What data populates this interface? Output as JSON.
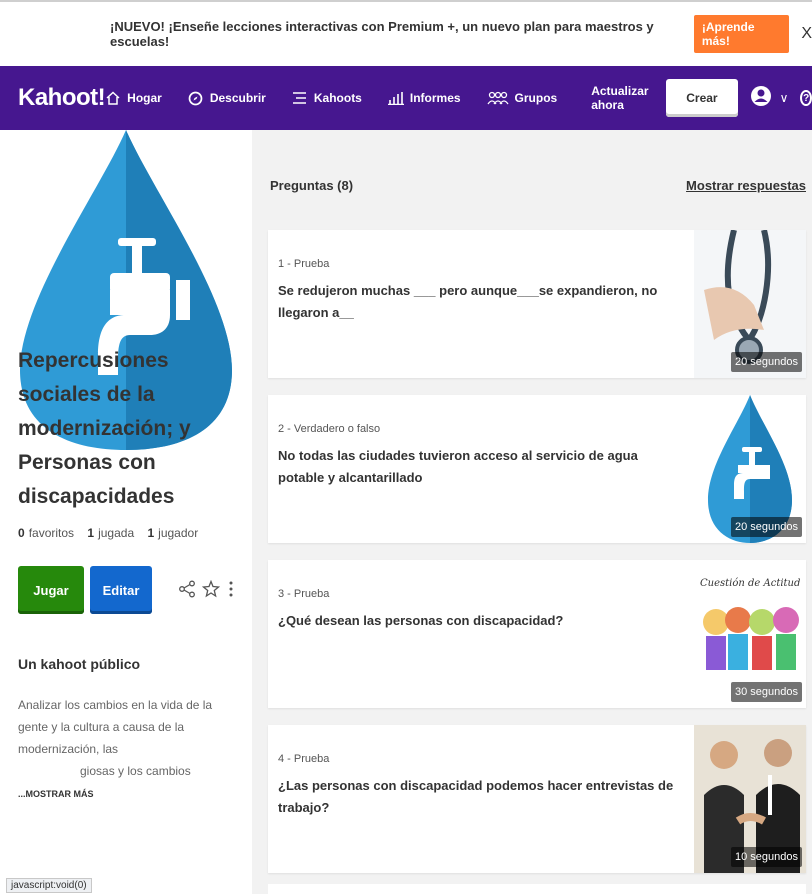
{
  "banner": {
    "text": "¡NUEVO! ¡Enseñe lecciones interactivas con Premium +, un nuevo plan para maestros y escuelas!",
    "button": "¡Aprende más!",
    "close": "X"
  },
  "nav": {
    "logo": "Kahoot!",
    "items": [
      {
        "label": "Hogar",
        "icon": "home-icon"
      },
      {
        "label": "Descubrir",
        "icon": "compass-icon"
      },
      {
        "label": "Kahoots",
        "icon": "list-icon"
      },
      {
        "label": "Informes",
        "icon": "reports-icon"
      },
      {
        "label": "Grupos",
        "icon": "groups-icon"
      }
    ],
    "upgrade": "Actualizar ahora",
    "create": "Crear",
    "user_icon": "user-icon",
    "chevron": "∨",
    "help": "?",
    "brand_color": "#46178f"
  },
  "kahoot": {
    "title": "Repercusiones sociales de la modernización; y Personas con discapacidades",
    "stats": {
      "favorites_count": "0",
      "favorites_label": "favoritos",
      "plays_count": "1",
      "plays_label": "jugada",
      "players_count": "1",
      "players_label": "jugador"
    },
    "play": "Jugar",
    "edit": "Editar",
    "visibility": "Un kahoot público",
    "description": "Analizar los cambios en la vida de la gente y la cultura a causa de la modernización, las",
    "description_cont": "giosas y los cambios",
    "more": "...MOSTRAR MÁS",
    "status_tip": "javascript:void(0)"
  },
  "questions": {
    "header": "Preguntas (8)",
    "show_answers": "Mostrar respuestas",
    "items": [
      {
        "type": "1 - Prueba",
        "text": "Se redujeron muchas ___ pero aunque___se expandieron, no llegaron a__",
        "time": "20 segundos",
        "thumb": "stethoscope"
      },
      {
        "type": "2 - Verdadero o falso",
        "text": "No todas las ciudades tuvieron acceso al servicio de agua potable y alcantarillado",
        "time": "20 segundos",
        "thumb": "faucet"
      },
      {
        "type": "3 - Prueba",
        "text": "¿Qué desean las personas con discapacidad?",
        "time": "30 segundos",
        "thumb": "cartoon",
        "thumb_caption": "Cuestión de Actitud"
      },
      {
        "type": "4 - Prueba",
        "text": "¿Las personas con discapacidad podemos hacer entrevistas de trabajo?",
        "time": "10 segundos",
        "thumb": "handshake"
      }
    ]
  }
}
